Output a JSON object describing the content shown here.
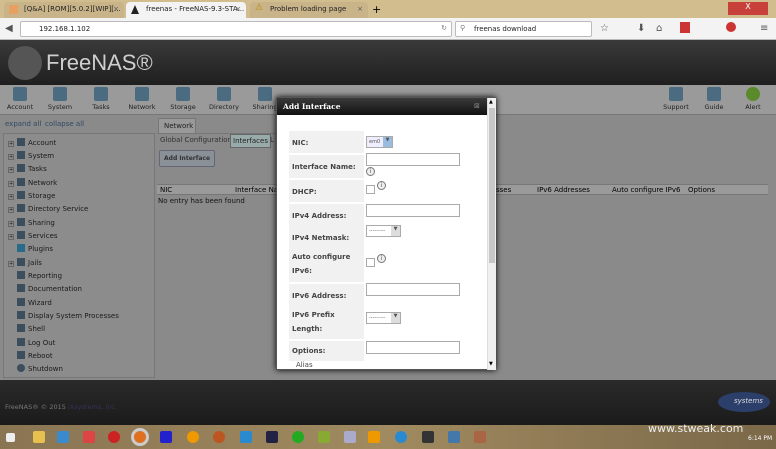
{
  "browser": {
    "tabs": [
      {
        "label": "[Q&A] [ROM][5.0.2][WIP][..."
      },
      {
        "label": "freenas - FreeNAS-9.3-STA..."
      },
      {
        "label": "Problem loading page"
      }
    ],
    "url": "192.168.1.102",
    "search": "freenas download"
  },
  "header": {
    "logo": "FreeNAS®"
  },
  "toolbar": {
    "items": [
      "Account",
      "System",
      "Tasks",
      "Network",
      "Storage",
      "Directory",
      "Sharing"
    ],
    "right": [
      "Support",
      "Guide",
      "Alert"
    ]
  },
  "sidebar": {
    "expand_all": "expand all",
    "collapse_all": "collapse all",
    "items": [
      "Account",
      "System",
      "Tasks",
      "Network",
      "Storage",
      "Directory Service",
      "Sharing",
      "Services",
      "Plugins",
      "Jails",
      "Reporting",
      "Documentation",
      "Wizard",
      "Display System Processes",
      "Shell",
      "Log Out",
      "Reboot",
      "Shutdown"
    ]
  },
  "main": {
    "tab": "Network",
    "subtabs": [
      "Global Configuration",
      "Interfaces",
      "L"
    ],
    "add_button": "Add Interface",
    "columns": [
      "NIC",
      "Interface Name",
      "",
      "sses",
      "IPv6 Addresses",
      "Auto configure IPv6",
      "Options"
    ],
    "empty": "No entry has been found"
  },
  "modal": {
    "title": "Add Interface",
    "nic_label": "NIC:",
    "nic_value": "em0",
    "name_label": "Interface Name:",
    "dhcp_label": "DHCP:",
    "ipv4_label": "IPv4 Address:",
    "netmask_label": "IPv4 Netmask:",
    "netmask_value": "---------",
    "auto6_label": "Auto configure IPv6:",
    "ipv6_label": "IPv6 Address:",
    "prefix_label": "IPv6 Prefix Length:",
    "prefix_value": "---------",
    "options_label": "Options:",
    "alias": "Alias"
  },
  "footer": {
    "copyright": "FreeNAS® © 2015",
    "company": "iXsystems, Inc.",
    "brand": "systems"
  },
  "taskbar": {
    "time": "6:14 PM",
    "watermark": "www.stweak.com"
  }
}
